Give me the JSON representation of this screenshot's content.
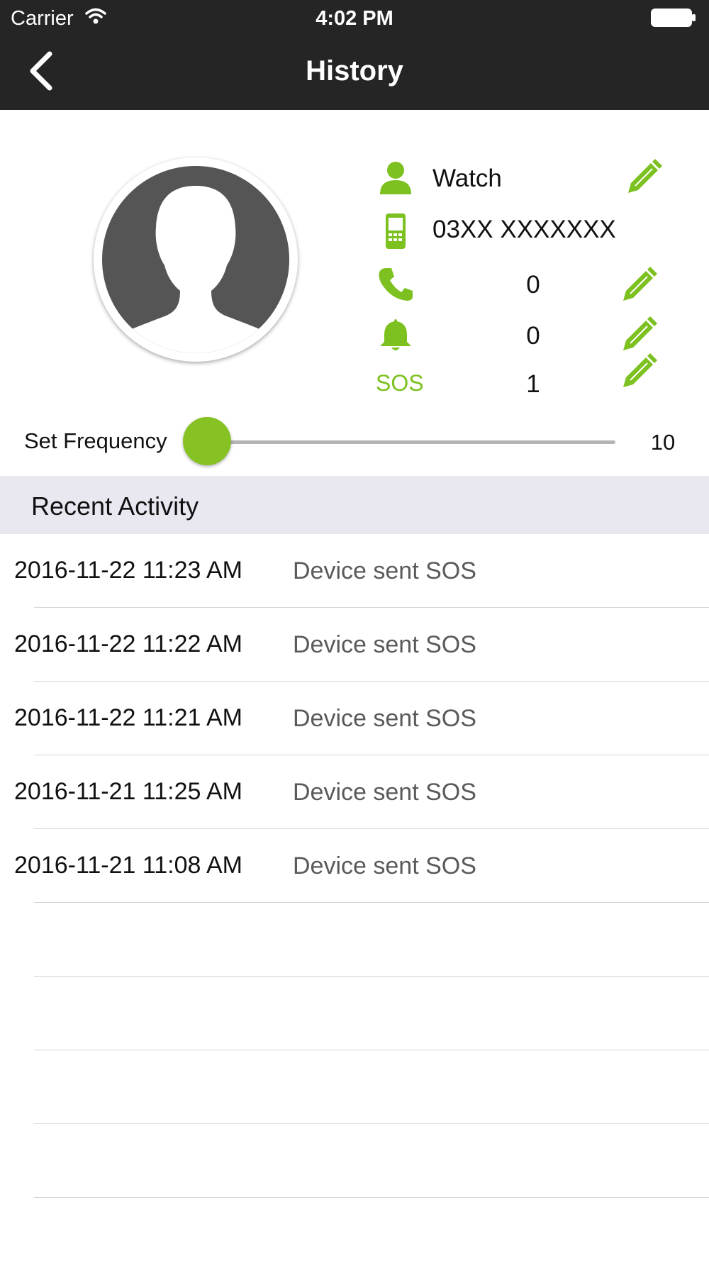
{
  "status_bar": {
    "carrier": "Carrier",
    "time": "4:02 PM",
    "wifi_icon": "wifi-icon",
    "battery_icon": "battery-icon"
  },
  "nav": {
    "title": "History",
    "back_icon": "chevron-left-icon"
  },
  "profile": {
    "avatar_icon": "user-silhouette-icon",
    "name": "Watch",
    "phone": "03XX XXXXXXX",
    "calls_count": "0",
    "alerts_count": "0",
    "sos_label": "SOS",
    "sos_count": "1"
  },
  "frequency": {
    "label": "Set Frequency",
    "value": "10",
    "slider_fraction": 0.0
  },
  "recent_activity": {
    "title": "Recent Activity",
    "items": [
      {
        "time": "2016-11-22 11:23 AM",
        "description": "Device sent SOS"
      },
      {
        "time": "2016-11-22 11:22 AM",
        "description": "Device sent SOS"
      },
      {
        "time": "2016-11-22 11:21 AM",
        "description": "Device sent SOS"
      },
      {
        "time": "2016-11-21 11:25 AM",
        "description": "Device sent SOS"
      },
      {
        "time": "2016-11-21 11:08 AM",
        "description": "Device sent SOS"
      }
    ]
  },
  "colors": {
    "accent": "#7cc11f",
    "nav_bar": "#252525",
    "section_header": "#e9e8f1",
    "avatar": "#555555"
  }
}
